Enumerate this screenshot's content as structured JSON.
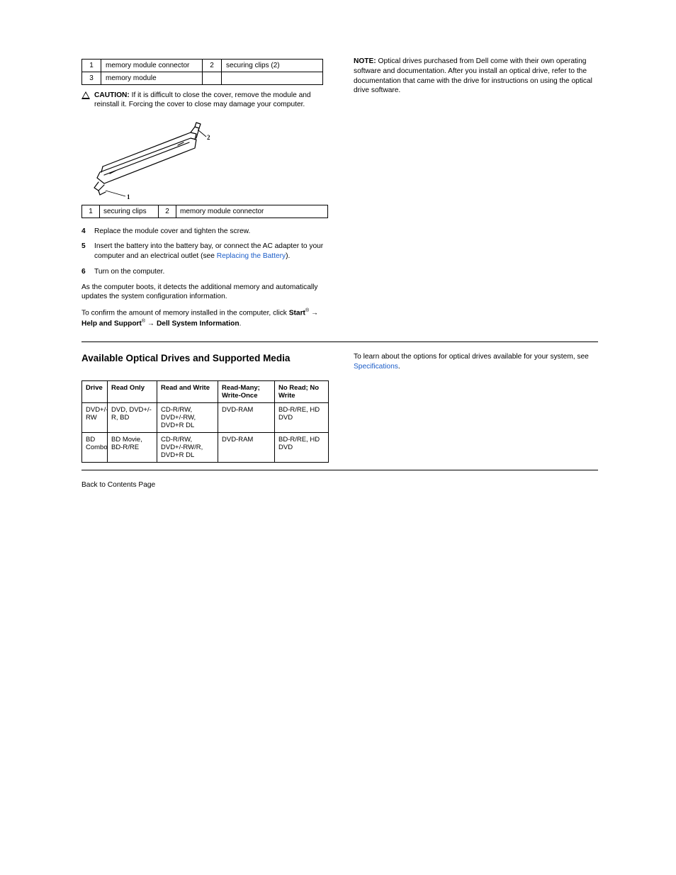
{
  "left": {
    "mini_table": {
      "r1c1": "1",
      "r1c2": "memory module connector",
      "r1c3": "2",
      "r1c4": "securing clips (2)",
      "r2c1": "3",
      "r2c2": "memory module"
    },
    "caution_label": "CAUTION:",
    "caution_text": "If it is difficult to close the cover, remove the module and reinstall it. Forcing the cover to close may damage your computer.",
    "key2": {
      "r1": "1",
      "r1t": "securing clips",
      "r2": "2",
      "r2t": "memory module connector"
    },
    "step4_n": "4",
    "step4_t": "Replace the module cover and tighten the screw.",
    "step5_n": "5",
    "step5_pre": "Insert the battery into the battery bay, or connect the AC adapter to your computer and an electrical outlet (see ",
    "step5_link": "Replacing the Battery",
    "step5_post": ").",
    "step6_n": "6",
    "step6_t": "Turn on the computer.",
    "boot_para": "As the computer boots, it detects the additional memory and automatically updates the system configuration information.",
    "confirm_pre": "To confirm the amount of memory installed in the computer, click ",
    "confirm_start": "Start",
    "confirm_arrow1": "→ ",
    "confirm_hs": "Help and Support",
    "confirm_arrow2": "→ ",
    "confirm_dsi": "Dell System Information",
    "confirm_period": "."
  },
  "right": {
    "note_label": "NOTE:",
    "note_text": " Optical drives purchased from Dell come with their own operating software and documentation. After you install an optical drive, refer to the documentation that came with the drive for instructions on using the optical drive software.",
    "spec_intro_pre": "To learn about the options for optical drives available for your system, see ",
    "spec_link": "Specifications",
    "spec_intro_post": "."
  },
  "section2": {
    "title": "Available Optical Drives and Supported Media",
    "spec_table": {
      "h1": "Drive",
      "h2": "Read Only",
      "h3": "Read and Write",
      "h4": "Read-Many; Write-Once",
      "h5": "No Read; No Write",
      "r1c1": "DVD+/- RW",
      "r1c2": "DVD, DVD+/-R, BD",
      "r1c3": "CD-R/RW, DVD+/-RW, DVD+R DL",
      "r1c4": "DVD-RAM",
      "r1c5": "BD-R/RE, HD DVD",
      "r2c1": "BD Combo",
      "r2c2": "BD Movie, BD-R/RE",
      "r2c3": "CD-R/RW, DVD+/-RW/R, DVD+R DL",
      "r2c4": "DVD-RAM",
      "r2c5": "BD-R/RE, HD DVD"
    }
  },
  "footer": {
    "back": "Back to Contents Page"
  }
}
